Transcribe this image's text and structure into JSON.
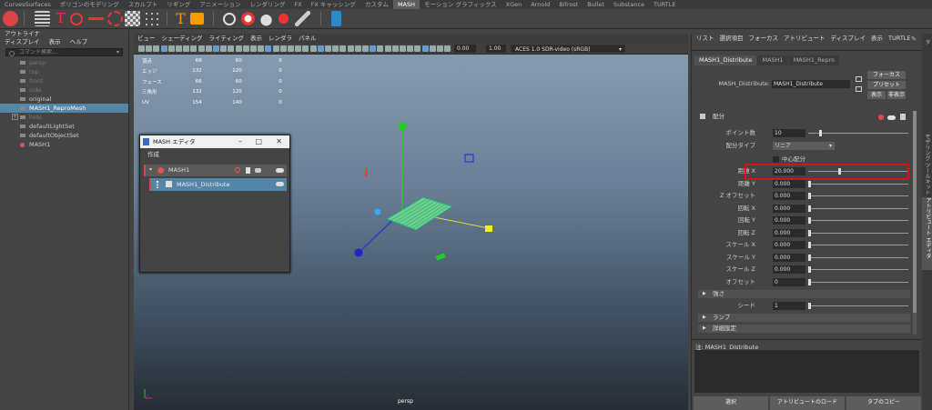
{
  "shelf_tabs": [
    "CurvesSurfaces",
    "ポリゴンのモデリング",
    "スカルプト",
    "リギング",
    "アニメーション",
    "レンダリング",
    "FX",
    "FX キャッシング",
    "カスタム",
    "MASH",
    "モーション グラフィックス",
    "XGen",
    "Arnold",
    "Bifrost",
    "Bullet",
    "Substance",
    "TURTLE"
  ],
  "active_shelf_tab": "MASH",
  "outliner": {
    "title": "アウトライナ",
    "menu": [
      "ディスプレイ",
      "表示",
      "ヘルプ"
    ],
    "search_placeholder": "コマンド検索...",
    "nodes": [
      {
        "label": "persp",
        "dim": true
      },
      {
        "label": "top",
        "dim": true
      },
      {
        "label": "front",
        "dim": true
      },
      {
        "label": "side",
        "dim": true
      },
      {
        "label": "original",
        "dim": false
      },
      {
        "label": "MASH1_ReproMesh",
        "dim": false,
        "selected": true
      },
      {
        "label": "hide",
        "dim": true,
        "expand": "+"
      },
      {
        "label": "defaultLightSet",
        "dim": false
      },
      {
        "label": "defaultObjectSet",
        "dim": false
      },
      {
        "label": "MASH1",
        "dim": false
      }
    ]
  },
  "viewport": {
    "menu": [
      "ビュー",
      "シェーディング",
      "ライティング",
      "表示",
      "レンダラ",
      "パネル"
    ],
    "field1": "0.00",
    "field2": "1.00",
    "colorspace": "ACES 1.0 SDR-video (sRGB)",
    "hud": [
      [
        "頂点",
        "66",
        "60",
        "0"
      ],
      [
        "エッジ",
        "132",
        "120",
        "0"
      ],
      [
        "フェース",
        "66",
        "60",
        "0"
      ],
      [
        "三角形",
        "132",
        "120",
        "0"
      ],
      [
        "UV",
        "154",
        "140",
        "0"
      ]
    ],
    "camera_label": "persp"
  },
  "mash_editor": {
    "title": "MASH エディタ",
    "create_label": "作成",
    "network": "MASH1",
    "node": "MASH1_Distribute"
  },
  "attribute_editor": {
    "menu": [
      "リスト",
      "選択項目",
      "フォーカス",
      "アトリビュート",
      "ディスプレイ",
      "表示",
      "TURTLE"
    ],
    "tabs": [
      "MASH1_Distribute",
      "MASH1",
      "MASH1_Repro"
    ],
    "node_label": "MASH_Distribute:",
    "node_value": "MASH1_Distribute",
    "focus_btn": "フォーカス",
    "preset_btn": "プリセット",
    "show_btn": "表示",
    "hide_btn": "非表示",
    "section_title": "配分",
    "point_count_label": "ポイント数",
    "point_count": "10",
    "dist_type_label": "配分タイプ",
    "dist_type": "リニア",
    "center_label": "中心配分",
    "attrs": [
      {
        "label": "距離 X",
        "value": "20.000",
        "knob": 0.3
      },
      {
        "label": "距離 Y",
        "value": "0.000",
        "knob": 0
      },
      {
        "label": "Z オフセット",
        "value": "0.000",
        "knob": 0
      },
      {
        "label": "回転 X",
        "value": "0.000",
        "knob": 0
      },
      {
        "label": "回転 Y",
        "value": "0.000",
        "knob": 0
      },
      {
        "label": "回転 Z",
        "value": "0.000",
        "knob": 0
      },
      {
        "label": "スケール X",
        "value": "0.000",
        "knob": 0
      },
      {
        "label": "スケール Y",
        "value": "0.000",
        "knob": 0
      },
      {
        "label": "スケール Z",
        "value": "0.000",
        "knob": 0
      },
      {
        "label": "オフセット",
        "value": "0",
        "knob": 0
      }
    ],
    "strength_section": "強さ",
    "seed_label": "シード",
    "seed_value": "1",
    "ramp_section": "ランプ",
    "advanced_section": "詳細設定",
    "notes_label": "注: MASH1_Distribute",
    "bottom_buttons": [
      "選択",
      "アトリビュートのロード",
      "タブのコピー"
    ]
  },
  "right_strip": [
    "チャンネル ボックス/レイヤ エディタ",
    "モデリング ツールキット",
    "アトリビュート エディタ"
  ]
}
